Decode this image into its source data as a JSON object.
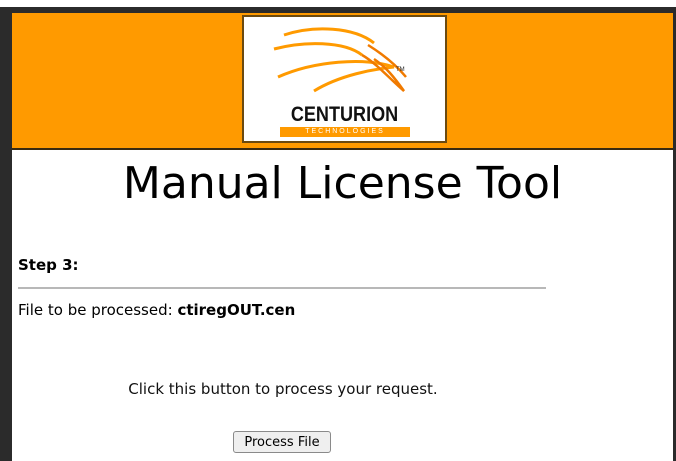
{
  "brand": {
    "name": "CENTURION",
    "tagline": "TECHNOLOGIES",
    "trademark": "TM",
    "accent_color": "#ff9a00",
    "logo_icon": "centurion-swoosh-logo"
  },
  "page": {
    "title": "Manual License Tool"
  },
  "step": {
    "label": "Step 3:"
  },
  "file": {
    "prefix": "File to be processed: ",
    "name": "ctiregOUT.cen"
  },
  "instruction": {
    "text": "Click this button to process your request."
  },
  "actions": {
    "process_label": "Process File"
  }
}
